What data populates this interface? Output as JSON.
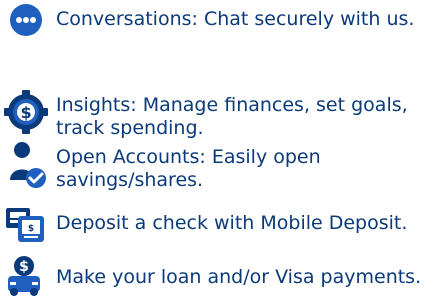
{
  "colors": {
    "primary": "#0b3a7a",
    "secondary": "#1f5fbf",
    "white": "#ffffff"
  },
  "features": [
    {
      "icon": "chat-bubble-icon",
      "text": "Conversations: Chat securely with us."
    },
    {
      "icon": "dollar-gear-icon",
      "text": "Insights: Manage finances, set goals, track spending."
    },
    {
      "icon": "user-check-icon",
      "text": "Open Accounts: Easily open savings/shares."
    },
    {
      "icon": "mobile-deposit-icon",
      "text": "Deposit a check with Mobile Deposit."
    },
    {
      "icon": "loan-payment-icon",
      "text": "Make your loan and/or Visa payments."
    }
  ]
}
